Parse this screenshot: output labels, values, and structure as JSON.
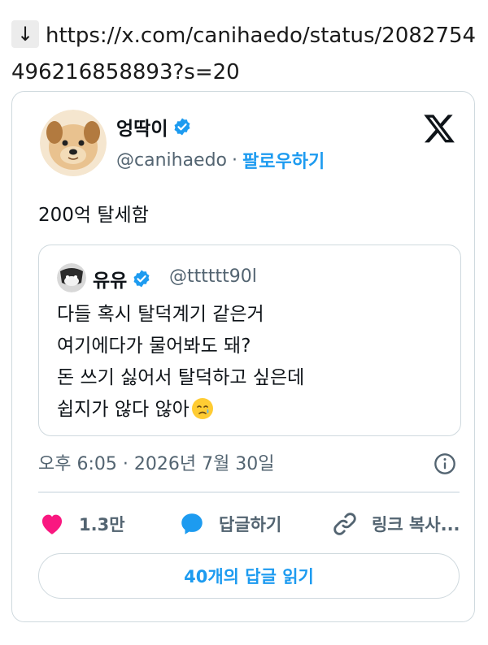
{
  "url": {
    "arrow": "↓",
    "text": "https://x.com/canihaedo/status/2082754496216858893?s=20"
  },
  "author": {
    "name": "엉딱이",
    "handle": "@canihaedo",
    "separator": "·",
    "follow_label": "팔로우하기",
    "verified": true
  },
  "tweet": {
    "text": "200억 탈세함"
  },
  "quoted": {
    "name": "유유",
    "handle": "@tttttt90l",
    "verified": true,
    "lines": [
      "다들 혹시 탈덕계기 같은거",
      "여기에다가 물어봐도 돼?",
      "돈 쓰기 싫어서 탈덕하고 싶은데",
      "쉽지가 않다 않아"
    ],
    "trailing_emoji": "face-holding-back-tears"
  },
  "timestamp": "오후 6:05 · 2026년 7월 30일",
  "actions": {
    "likes_count": "1.3만",
    "reply_label": "답글하기",
    "copy_link_label": "링크 복사..."
  },
  "read_replies_label": "40개의 답글 읽기",
  "colors": {
    "accent": "#1d9bf0",
    "like": "#f91880",
    "border": "#cfd9de",
    "muted": "#536471"
  },
  "icons": {
    "verified": "verified-badge-icon",
    "x_logo": "x-logo-icon",
    "info": "info-icon",
    "like": "heart-icon",
    "reply": "reply-bubble-icon",
    "link": "link-icon"
  }
}
